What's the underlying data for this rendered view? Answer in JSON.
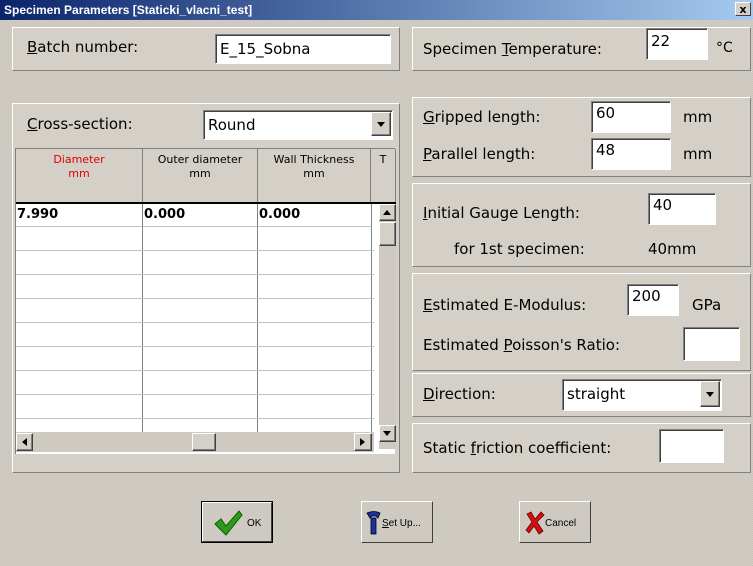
{
  "window": {
    "title": "Specimen Parameters [Staticki_vlacni_test]",
    "close_label": "x"
  },
  "batch": {
    "label_pre": "",
    "label_u": "B",
    "label_post": "atch number:",
    "value": "E_15_Sobna"
  },
  "cross_section": {
    "label_u": "C",
    "label_post": "ross-section:",
    "value": "Round"
  },
  "table": {
    "headers": [
      {
        "line1": "Diameter",
        "line2": "mm"
      },
      {
        "line1": "Outer diameter",
        "line2": "mm"
      },
      {
        "line1": "Wall Thickness",
        "line2": "mm"
      },
      {
        "line1": "T",
        "line2": ""
      }
    ],
    "first_row": [
      "7.990",
      "0.000",
      "0.000"
    ]
  },
  "temperature": {
    "label_pre": "Specimen ",
    "label_u": "T",
    "label_post": "emperature:",
    "value": "22",
    "unit": "°C"
  },
  "gripped": {
    "label_u": "G",
    "label_post": "ripped length:",
    "value": "60",
    "unit": "mm"
  },
  "parallel": {
    "label_u": "P",
    "label_post": "arallel length:",
    "value": "48",
    "unit": "mm"
  },
  "gauge": {
    "label_u": "I",
    "label_post": "nitial Gauge Length:",
    "value": "40",
    "first_label": "for 1st specimen:",
    "first_value": "40mm"
  },
  "emodulus": {
    "label_u": "E",
    "label_post": "stimated E-Modulus:",
    "value": "200",
    "unit": "GPa"
  },
  "poisson": {
    "label_pre": "Estimated ",
    "label_u": "P",
    "label_post": "oisson's Ratio:",
    "value": ""
  },
  "direction": {
    "label_u": "D",
    "label_post": "irection:",
    "value": "straight"
  },
  "friction": {
    "label_pre": "Static ",
    "label_u": "f",
    "label_post": "riction coefficient:",
    "value": ""
  },
  "buttons": {
    "ok": "OK",
    "setup_u": "S",
    "setup_post": "et Up...",
    "cancel": "Cancel"
  },
  "colors": {
    "header_red": "#e00000",
    "title_start": "#0a246a",
    "title_end": "#a6caf0"
  }
}
